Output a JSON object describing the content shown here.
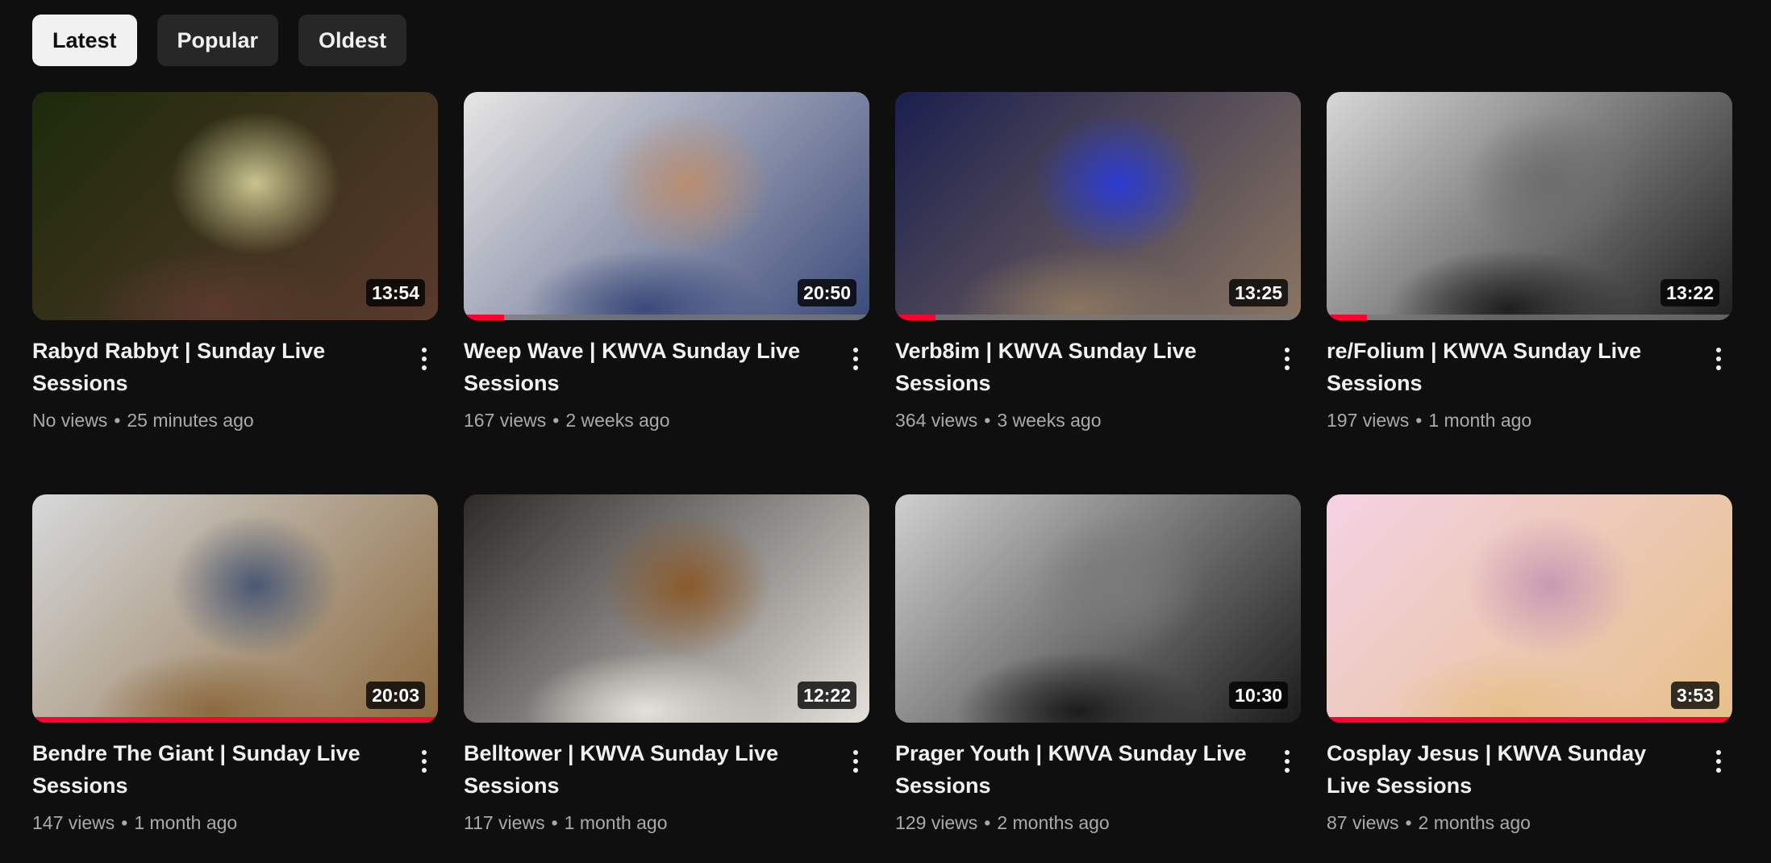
{
  "filters": {
    "chips": [
      {
        "label": "Latest",
        "active": true
      },
      {
        "label": "Popular",
        "active": false
      },
      {
        "label": "Oldest",
        "active": false
      }
    ]
  },
  "videos": [
    {
      "title": "Rabyd Rabbyt | Sunday Live Sessions",
      "views": "No views",
      "age": "25 minutes ago",
      "duration": "13:54",
      "watched": 0,
      "palette": [
        "#1c2a0a",
        "#c9c48e",
        "#5a3a2e"
      ],
      "tone": "color"
    },
    {
      "title": "Weep Wave | KWVA Sunday Live Sessions",
      "views": "167 views",
      "age": "2 weeks ago",
      "duration": "20:50",
      "watched": 0.1,
      "palette": [
        "#e8e6e4",
        "#b98e73",
        "#3b4a7a"
      ],
      "tone": "color"
    },
    {
      "title": "Verb8im | KWVA Sunday Live Sessions",
      "views": "364 views",
      "age": "3 weeks ago",
      "duration": "13:25",
      "watched": 0.1,
      "palette": [
        "#1a1f4f",
        "#2b3bd1",
        "#8a7560"
      ],
      "tone": "color"
    },
    {
      "title": "re/Folium | KWVA Sunday Live Sessions",
      "views": "197 views",
      "age": "1 month ago",
      "duration": "13:22",
      "watched": 0.1,
      "palette": [
        "#d7d7d7",
        "#6d6d6d",
        "#1f1f1f"
      ],
      "tone": "gray"
    },
    {
      "title": "Bendre The Giant | Sunday Live Sessions",
      "views": "147 views",
      "age": "1 month ago",
      "duration": "20:03",
      "watched": 1,
      "palette": [
        "#d5d8da",
        "#4a5874",
        "#8c6a3e"
      ],
      "tone": "color"
    },
    {
      "title": "Belltower | KWVA Sunday Live Sessions",
      "views": "117 views",
      "age": "1 month ago",
      "duration": "12:22",
      "watched": 0,
      "palette": [
        "#2e2a28",
        "#8a5a2b",
        "#e4e0dc"
      ],
      "tone": "color"
    },
    {
      "title": "Prager Youth | KWVA Sunday Live Sessions",
      "views": "129 views",
      "age": "2 months ago",
      "duration": "10:30",
      "watched": 0,
      "palette": [
        "#cfcfcf",
        "#7a7a7a",
        "#1c1c1c"
      ],
      "tone": "gray"
    },
    {
      "title": "Cosplay Jesus | KWVA Sunday Live Sessions",
      "views": "87 views",
      "age": "2 months ago",
      "duration": "3:53",
      "watched": 1,
      "palette": [
        "#f4d2e4",
        "#c99ab4",
        "#e6c08a"
      ],
      "tone": "color"
    }
  ],
  "icons": {
    "menu": "more-vert-icon"
  }
}
